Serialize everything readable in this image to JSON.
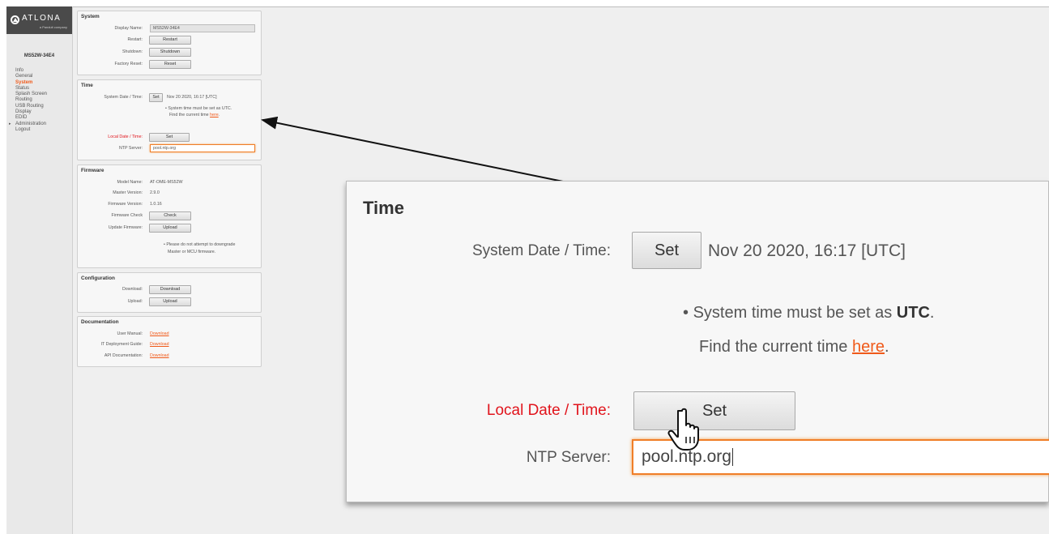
{
  "brand": {
    "logo_text": "ATLONA",
    "logo_sub": "a Panduit company"
  },
  "sidebar": {
    "device_name": "MS52W-34E4",
    "items": [
      {
        "label": "Info"
      },
      {
        "label": "General"
      },
      {
        "label": "System",
        "active": true
      },
      {
        "label": "Status"
      },
      {
        "label": "Splash Screen"
      },
      {
        "label": "Routing"
      },
      {
        "label": "USB Routing"
      },
      {
        "label": "Display"
      },
      {
        "label": "EDID"
      },
      {
        "label": "Administration",
        "expandable": true
      },
      {
        "label": "Logout"
      }
    ]
  },
  "system": {
    "title": "System",
    "display_name_label": "Display Name:",
    "display_name_value": "MS52W-34E4",
    "restart_label": "Restart:",
    "restart_button": "Restart",
    "shutdown_label": "Shutdown:",
    "shutdown_button": "Shutdown",
    "factory_reset_label": "Factory Reset:",
    "reset_button": "Reset"
  },
  "time": {
    "title": "Time",
    "system_datetime_label": "System Date / Time:",
    "set_button": "Set",
    "system_datetime_value": "Nov 20 2020, 16:17 [UTC]",
    "note_bullet": "•",
    "note_line1_prefix": "System time must be set as ",
    "note_line1_utc": "UTC",
    "note_line1_suffix": ".",
    "note_line2_prefix": "Find the current time ",
    "note_link": "here",
    "note_line2_suffix": ".",
    "local_datetime_label": "Local Date / Time:",
    "local_set_button": "Set",
    "ntp_label": "NTP Server:",
    "ntp_value": "pool.ntp.org"
  },
  "firmware": {
    "title": "Firmware",
    "model_name_label": "Model Name:",
    "model_name_value": "AT-OME-MS52W",
    "master_version_label": "Master Version:",
    "master_version_value": "2.9.0",
    "firmware_version_label": "Firmware Version:",
    "firmware_version_value": "1.0.16",
    "firmware_check_label": "Firmware Check",
    "check_button": "Check",
    "update_firmware_label": "Update Firmware:",
    "upload_button": "Upload",
    "note_line1": "Please do not attempt to downgrade",
    "note_line2": "Master or MCU firmware."
  },
  "configuration": {
    "title": "Configuration",
    "download_label": "Download:",
    "download_button": "Download",
    "upload_label": "Upload:",
    "upload_button": "Upload"
  },
  "documentation": {
    "title": "Documentation",
    "user_manual_label": "User Manual:",
    "user_manual_link": "Download",
    "it_guide_label": "IT Deployment Guide:",
    "it_guide_link": "Download",
    "api_doc_label": "API Documentation:",
    "api_doc_link": "Download"
  },
  "colors": {
    "accent": "#f05a1a",
    "required_label": "#e1141c",
    "focus_border": "#f07e28",
    "logo_bar": "#4a4a4a"
  }
}
